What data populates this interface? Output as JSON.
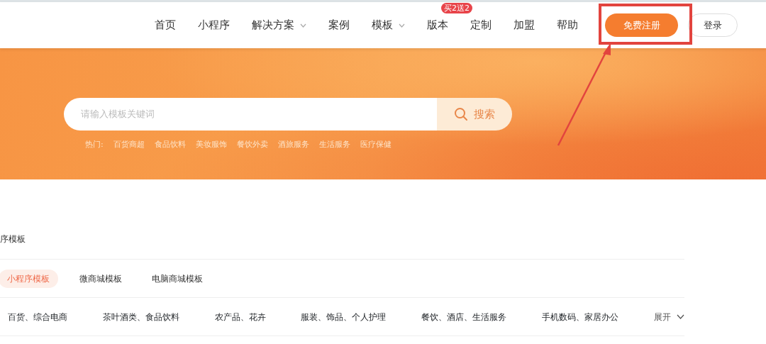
{
  "nav": {
    "items": [
      {
        "label": "首页",
        "dropdown": false
      },
      {
        "label": "小程序",
        "dropdown": false
      },
      {
        "label": "解决方案",
        "dropdown": true
      },
      {
        "label": "案例",
        "dropdown": false
      },
      {
        "label": "模板",
        "dropdown": true
      },
      {
        "label": "版本",
        "dropdown": false,
        "badge": "买2送2"
      },
      {
        "label": "定制",
        "dropdown": false
      },
      {
        "label": "加盟",
        "dropdown": false
      },
      {
        "label": "帮助",
        "dropdown": false
      }
    ],
    "register_button": "免费注册",
    "login_button": "登录"
  },
  "search": {
    "placeholder": "请输入模板关键词",
    "button": "搜索",
    "hot_label": "热门:",
    "hot_tags": [
      "百货商超",
      "食品饮料",
      "美妆服饰",
      "餐饮外卖",
      "酒旅服务",
      "生活服务",
      "医疗保健"
    ]
  },
  "section_title": "序模板",
  "tabs": [
    {
      "label": "小程序模板",
      "selected": true
    },
    {
      "label": "微商城模板",
      "selected": false
    },
    {
      "label": "电脑商城模板",
      "selected": false
    }
  ],
  "categories": [
    "百货、综合电商",
    "茶叶酒类、食品饮料",
    "农产品、花卉",
    "服装、饰品、个人护理",
    "餐饮、酒店、生活服务",
    "手机数码、家居办公"
  ],
  "expand": "展开"
}
